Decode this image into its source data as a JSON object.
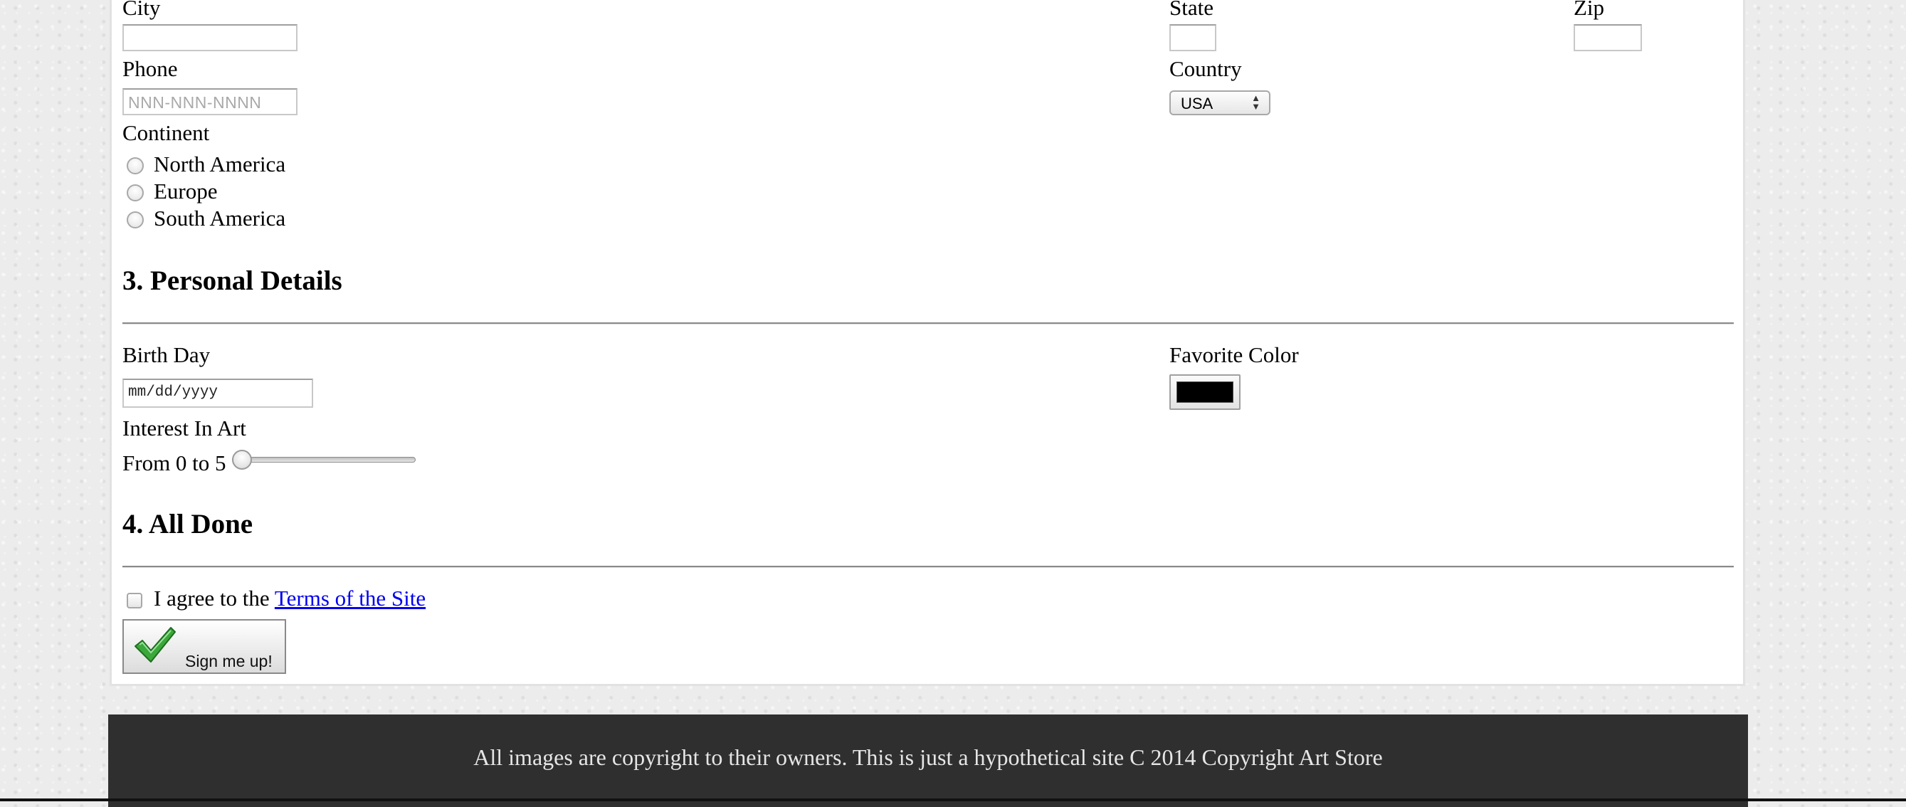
{
  "address": {
    "city_label": "City",
    "state_label": "State",
    "zip_label": "Zip",
    "phone_label": "Phone",
    "phone_placeholder": "NNN-NNN-NNNN",
    "country_label": "Country",
    "country_value": "USA",
    "continent_label": "Continent",
    "continents": [
      "North America",
      "Europe",
      "South America"
    ]
  },
  "personal": {
    "heading": "3. Personal Details",
    "birthday_label": "Birth Day",
    "birthday_format": "mm/dd/yyyy",
    "favorite_color_label": "Favorite Color",
    "favorite_color_value": "#000000",
    "interest_label": "Interest In Art",
    "range_label": "From 0 to 5",
    "interest_value": 0
  },
  "done": {
    "heading": "4. All Done",
    "agree_text": "I agree to the",
    "terms_link": "Terms of the Site",
    "submit_label": "Sign me up!",
    "submit_icon": "checkmark-icon"
  },
  "footer": {
    "text": "All images are copyright to their owners. This is just a hypothetical site C 2014 Copyright Art Store"
  }
}
